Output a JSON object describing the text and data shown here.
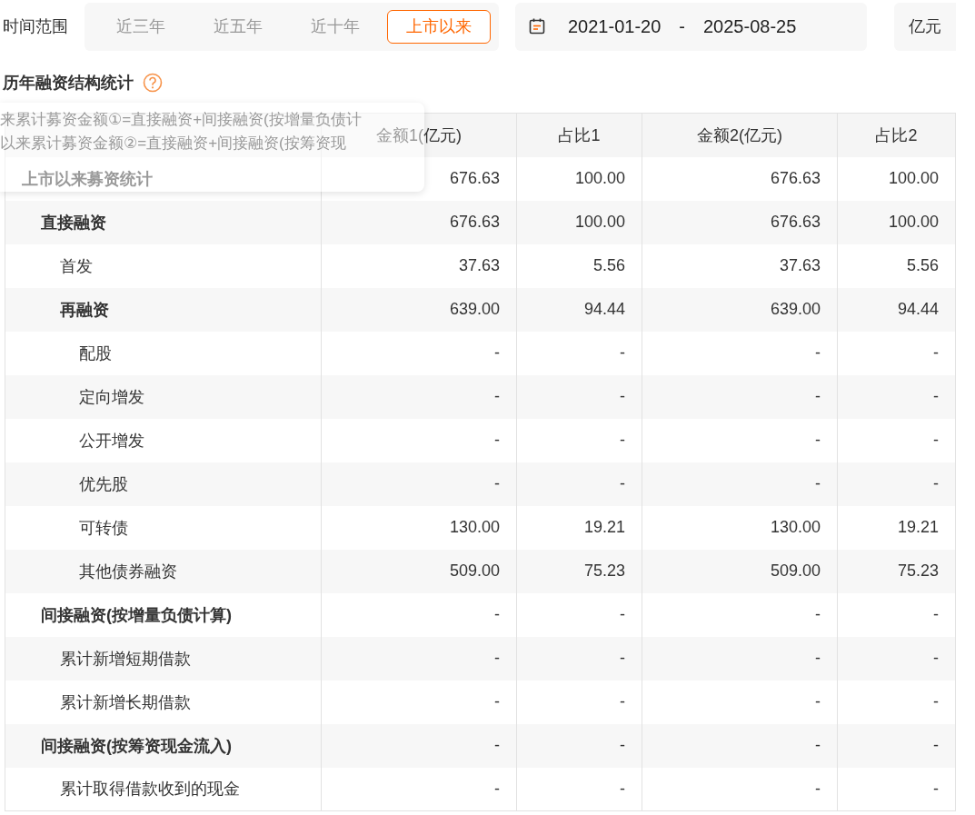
{
  "time_range": {
    "label": "时间范围",
    "tabs": [
      {
        "label": "近三年",
        "selected": false
      },
      {
        "label": "近五年",
        "selected": false
      },
      {
        "label": "近十年",
        "selected": false
      },
      {
        "label": "上市以来",
        "selected": true
      }
    ]
  },
  "date_range": {
    "start": "2021-01-20",
    "separator": "-",
    "end": "2025-08-25"
  },
  "unit": "亿元",
  "section_title": "历年融资结构统计",
  "tooltip": {
    "lines": [
      "来累计募资金额①=直接融资+间接融资(按增量负债计",
      "以来累计募资金额②=直接融资+间接融资(按筹资现"
    ]
  },
  "table": {
    "columns": [
      "金额1(亿元)",
      "占比1",
      "金额2(亿元)",
      "占比2"
    ],
    "rows": [
      {
        "label": "上市以来募资统计",
        "values": [
          "676.63",
          "100.00",
          "676.63",
          "100.00"
        ],
        "children": [
          {
            "label": "直接融资",
            "values": [
              "676.63",
              "100.00",
              "676.63",
              "100.00"
            ],
            "children": [
              {
                "label": "首发",
                "values": [
                  "37.63",
                  "5.56",
                  "37.63",
                  "5.56"
                ]
              },
              {
                "label": "再融资",
                "values": [
                  "639.00",
                  "94.44",
                  "639.00",
                  "94.44"
                ],
                "children": [
                  {
                    "label": "配股",
                    "values": [
                      "-",
                      "-",
                      "-",
                      "-"
                    ]
                  },
                  {
                    "label": "定向增发",
                    "values": [
                      "-",
                      "-",
                      "-",
                      "-"
                    ]
                  },
                  {
                    "label": "公开增发",
                    "values": [
                      "-",
                      "-",
                      "-",
                      "-"
                    ]
                  },
                  {
                    "label": "优先股",
                    "values": [
                      "-",
                      "-",
                      "-",
                      "-"
                    ]
                  },
                  {
                    "label": "可转债",
                    "values": [
                      "130.00",
                      "19.21",
                      "130.00",
                      "19.21"
                    ]
                  },
                  {
                    "label": "其他债券融资",
                    "values": [
                      "509.00",
                      "75.23",
                      "509.00",
                      "75.23"
                    ]
                  }
                ]
              }
            ]
          },
          {
            "label": "间接融资(按增量负债计算)",
            "values": [
              "-",
              "-",
              "-",
              "-"
            ],
            "children": [
              {
                "label": "累计新增短期借款",
                "values": [
                  "-",
                  "-",
                  "-",
                  "-"
                ]
              },
              {
                "label": "累计新增长期借款",
                "values": [
                  "-",
                  "-",
                  "-",
                  "-"
                ]
              }
            ]
          },
          {
            "label": "间接融资(按筹资现金流入)",
            "values": [
              "-",
              "-",
              "-",
              "-"
            ],
            "children": [
              {
                "label": "累计取得借款收到的现金",
                "values": [
                  "-",
                  "-",
                  "-",
                  "-"
                ]
              }
            ]
          }
        ]
      }
    ]
  }
}
